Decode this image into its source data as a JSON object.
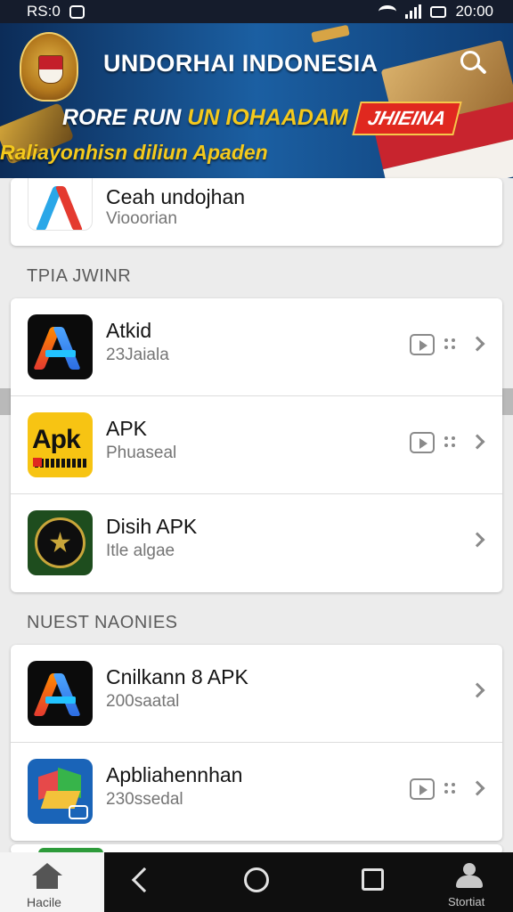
{
  "status_bar": {
    "time_left": "RS:0",
    "time_right": "20:00"
  },
  "banner": {
    "title": "UNDORHAI INDONESIA",
    "slogan_white": "RORE RUN",
    "slogan_yellow": "UN IOHAADAM",
    "badge": "JHIEINA",
    "subtitle": "Raliayonhisn diliun Apaden"
  },
  "top_card": {
    "name": "Ceah undojhan",
    "subtitle": "Viooorian"
  },
  "section1": {
    "label": "TPIA JWINR",
    "items": [
      {
        "name": "Atkid",
        "subtitle": "23Jaiala",
        "icon": "colorful-a-icon"
      },
      {
        "name": "APK",
        "subtitle": "Phuaseal",
        "icon": "yellow-apk-icon",
        "icon_text": "Apk"
      },
      {
        "name": "Disih APK",
        "subtitle": "Itle algae",
        "icon": "green-emblem-icon"
      }
    ]
  },
  "section2": {
    "label": "NUEST NAONIES",
    "items": [
      {
        "name": "Cnilkann 8 APK",
        "subtitle": "200saatal",
        "icon": "colorful-a-icon"
      },
      {
        "name": "Apbliahennhan",
        "subtitle": "230ssedal",
        "icon": "cube-icon"
      }
    ]
  },
  "bottom_nav": {
    "home_label": "Hacile",
    "profile_label": "Stortiat"
  },
  "colors": {
    "banner_bg": "#1b5fa2",
    "accent_yellow": "#f4c91c",
    "nav_bg": "#0f0f0f",
    "card_bg": "#ffffff"
  }
}
